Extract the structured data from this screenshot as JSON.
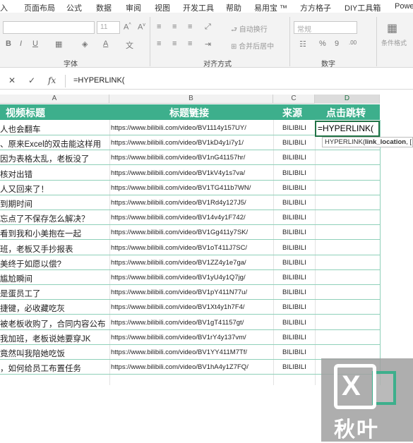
{
  "ribbon": {
    "tabs": [
      "入",
      "页面布局",
      "公式",
      "数据",
      "审阅",
      "视图",
      "开发工具",
      "帮助",
      "易用宝 ™",
      "方方格子",
      "DIY工具箱",
      "Powe"
    ],
    "font_name": "",
    "font_size": "11",
    "wrap_text": "自动换行",
    "merge_center": "合并后居中",
    "number_format": "常规",
    "group_font": "字体",
    "group_align": "对齐方式",
    "group_number": "数字",
    "cond_format": "条件格式"
  },
  "formula_bar": {
    "cancel": "✕",
    "confirm": "✓",
    "fx": "fx",
    "formula": "=HYPERLINK("
  },
  "columns": [
    "A",
    "B",
    "C",
    "D"
  ],
  "header": {
    "col_a": "视频标题",
    "col_b": "标题链接",
    "col_c": "来源",
    "col_d": "点击跳转"
  },
  "rows": [
    {
      "title": "人也会翻车",
      "link": "https://www.bilibili.com/video/BV1114y157UY/",
      "source": "BILIBILI"
    },
    {
      "title": "、原来Excel的双击能这样用",
      "link": "https://www.bilibili.com/video/BV1kD4y1i7y1/",
      "source": "BILIBILI"
    },
    {
      "title": "因为表格太乱，老板没了",
      "link": "https://www.bilibili.com/video/BV1nG41157hr/",
      "source": "BILIBILI"
    },
    {
      "title": "核对出错",
      "link": "https://www.bilibili.com/video/BV1kV4y1s7va/",
      "source": "BILIBILI"
    },
    {
      "title": "人又回来了！",
      "link": "https://www.bilibili.com/video/BV1TG411b7WN/",
      "source": "BILIBILI"
    },
    {
      "title": "到期时间",
      "link": "https://www.bilibili.com/video/BV1Rd4y127J5/",
      "source": "BILIBILI"
    },
    {
      "title": "忘点了不保存怎么解决？",
      "link": "https://www.bilibili.com/video/BV14v4y1F742/",
      "source": "BILIBILI"
    },
    {
      "title": "看到我和小美抱在一起",
      "link": "https://www.bilibili.com/video/BV1Gg411y7SK/",
      "source": "BILIBILI"
    },
    {
      "title": "班，老板又手抄报表",
      "link": "https://www.bilibili.com/video/BV1oT411J7SC/",
      "source": "BILIBILI"
    },
    {
      "title": "美终于如愿以偿?",
      "link": "https://www.bilibili.com/video/BV1ZZ4y1e7ga/",
      "source": "BILIBILI"
    },
    {
      "title": "尴尬瞬间",
      "link": "https://www.bilibili.com/video/BV1yU4y1Q7jg/",
      "source": "BILIBILI"
    },
    {
      "title": "是蛋员工了",
      "link": "https://www.bilibili.com/video/BV1pY411N77u/",
      "source": "BILIBILI"
    },
    {
      "title": "捷键，必收藏吃灰",
      "link": "https://www.bilibili.com/video/BV1Xt4y1h7F4/",
      "source": "BILIBILI"
    },
    {
      "title": "被老板收购了，合同内容公布",
      "link": "https://www.bilibili.com/video/BV1gT41157gt/",
      "source": "BILIBILI"
    },
    {
      "title": "我加班，老板说她要穿JK",
      "link": "https://www.bilibili.com/video/BV1rY4y137vm/",
      "source": "BILIBILI"
    },
    {
      "title": "竟然叫我陪她吃饭",
      "link": "https://www.bilibili.com/video/BV1YY411M7Tf/",
      "source": "BILIBILI"
    },
    {
      "title": "，如何给员工布置任务",
      "link": "https://www.bilibili.com/video/BV1hA4y1Z7FQ/",
      "source": "BILIBILI"
    }
  ],
  "edit_cell": "=HYPERLINK(",
  "tooltip": {
    "func": "HYPERLINK(",
    "arg": "link_location",
    "rest": ", ["
  },
  "watermark": {
    "text": "秋叶",
    "letter": "X"
  }
}
